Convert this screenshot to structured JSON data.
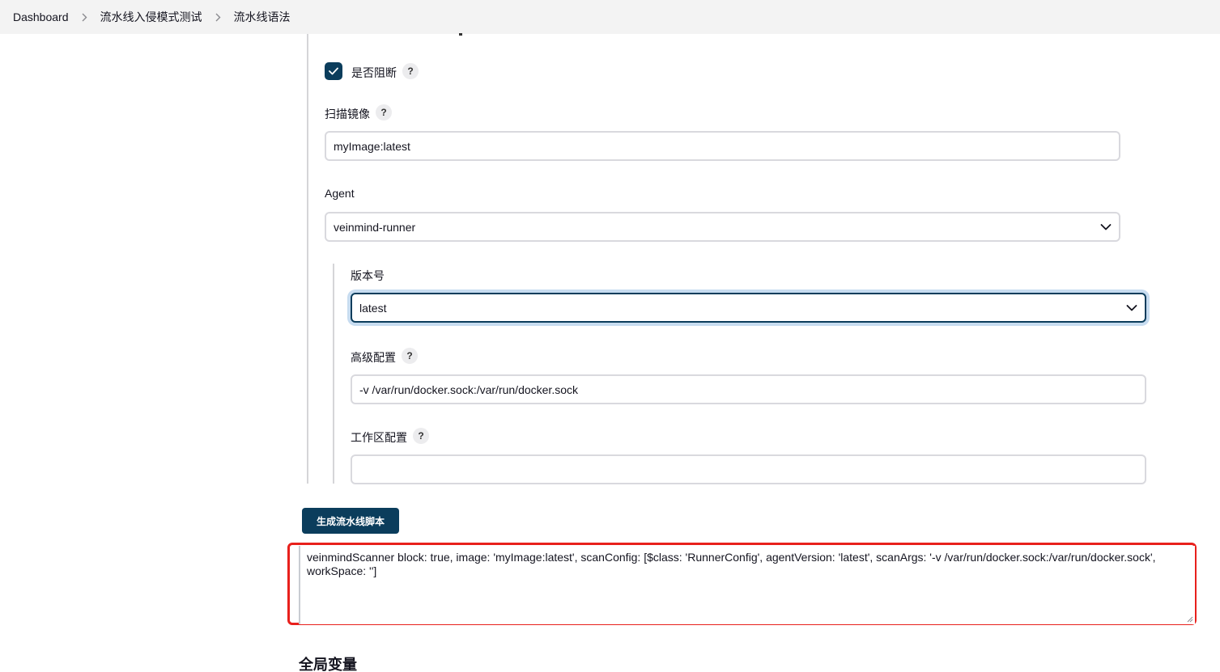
{
  "breadcrumb": {
    "items": [
      "Dashboard",
      "流水线入侵模式测试",
      "流水线语法"
    ]
  },
  "form": {
    "block": {
      "label": "是否阻断",
      "checked": true,
      "help": "?"
    },
    "image": {
      "label": "扫描镜像",
      "help": "?",
      "value": "myImage:latest"
    },
    "agent": {
      "label": "Agent",
      "selected": "veinmind-runner"
    },
    "version": {
      "label": "版本号",
      "selected": "latest"
    },
    "advanced": {
      "label": "高级配置",
      "help": "?",
      "value": "-v /var/run/docker.sock:/var/run/docker.sock"
    },
    "workspace": {
      "label": "工作区配置",
      "help": "?",
      "value": ""
    }
  },
  "generate_button": {
    "label": "生成流水线脚本"
  },
  "output": {
    "script": "veinmindScanner block: true, image: 'myImage:latest', scanConfig: [$class: 'RunnerConfig', agentVersion: 'latest', scanArgs: '-v /var/run/docker.sock:/var/run/docker.sock', workSpace: '']"
  },
  "global_section": {
    "title": "全局变量"
  },
  "colors": {
    "primary": "#0b3d5c",
    "highlight": "#e8201c",
    "breadcrumb_bg": "#f3f3f3"
  }
}
